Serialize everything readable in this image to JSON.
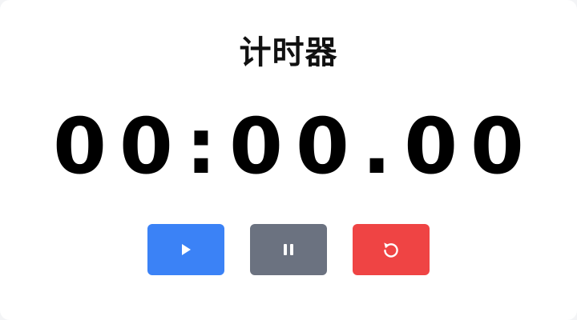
{
  "title": "计时器",
  "display": {
    "time": "00:00.00"
  },
  "controls": [
    {
      "name": "start",
      "icon": "play-icon",
      "color": "#3b82f6"
    },
    {
      "name": "pause",
      "icon": "pause-icon",
      "color": "#6b7280"
    },
    {
      "name": "reset",
      "icon": "reset-icon",
      "color": "#ef4444"
    }
  ]
}
